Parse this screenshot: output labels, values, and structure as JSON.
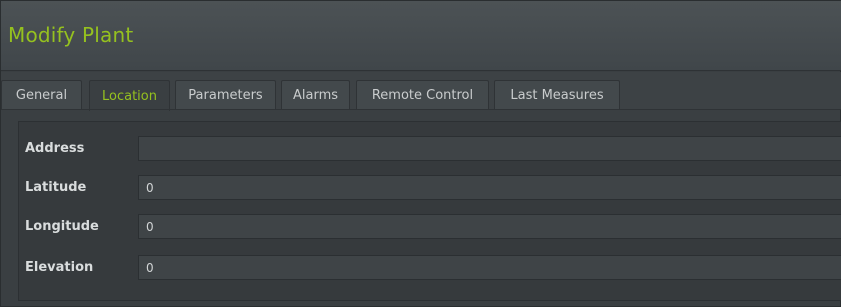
{
  "window": {
    "title": "Modify Plant"
  },
  "tabs": [
    {
      "label": "General",
      "active": false
    },
    {
      "label": "Location",
      "active": true
    },
    {
      "label": "Parameters",
      "active": false
    },
    {
      "label": "Alarms",
      "active": false
    },
    {
      "label": "Remote Control",
      "active": false
    },
    {
      "label": "Last Measures",
      "active": false
    }
  ],
  "form": {
    "address": {
      "label": "Address",
      "value": ""
    },
    "latitude": {
      "label": "Latitude",
      "value": "0"
    },
    "longitude": {
      "label": "Longitude",
      "value": "0"
    },
    "elevation": {
      "label": "Elevation",
      "value": "0"
    }
  },
  "colors": {
    "accent": "#95c11f",
    "background": "#3a3f42",
    "field": "#3f4447",
    "text": "#d9dcdd"
  }
}
